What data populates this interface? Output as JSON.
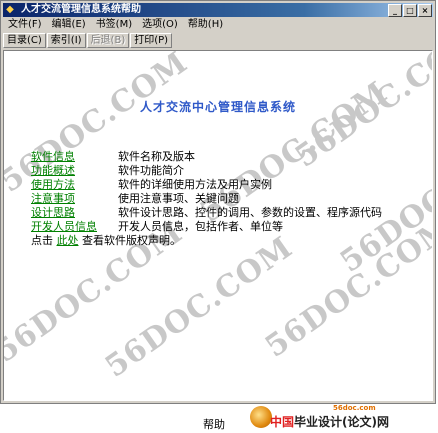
{
  "window": {
    "title": "人才交流管理信息系统帮助"
  },
  "menu": [
    "文件(F)",
    "编辑(E)",
    "书签(M)",
    "选项(O)",
    "帮助(H)"
  ],
  "toolbar": {
    "contents": "目录(C)",
    "index": "索引(I)",
    "back": "后退(B)",
    "print": "打印(P)"
  },
  "content": {
    "title": "人才交流中心管理信息系统",
    "entries": [
      {
        "link": "软件信息",
        "desc": "软件名称及版本"
      },
      {
        "link": "功能概述",
        "desc": "软件功能简介"
      },
      {
        "link": "使用方法",
        "desc": "软件的详细使用方法及用户实例"
      },
      {
        "link": "注意事项",
        "desc": "使用注意事项、关键问题"
      },
      {
        "link": "设计思路",
        "desc": "软件设计思路、控件的调用、参数的设置、程序源代码"
      },
      {
        "link": "开发人员信息",
        "desc": "开发人员信息，包括作者、单位等"
      }
    ],
    "note_prefix": "点击",
    "note_link": "此处",
    "note_suffix": "查看软件版权声明。",
    "watermarks": [
      "56DOC.COM",
      "56DOC.COM",
      "56DOC.COM",
      "56DOC.COM",
      "56DOC.COM",
      "56DOC.COM",
      "56DOC.COM"
    ]
  },
  "footer": {
    "caption": "帮助",
    "logo_url": "56doc.com",
    "logo_red": "中国",
    "logo_black": "毕业设计(论文)网"
  }
}
